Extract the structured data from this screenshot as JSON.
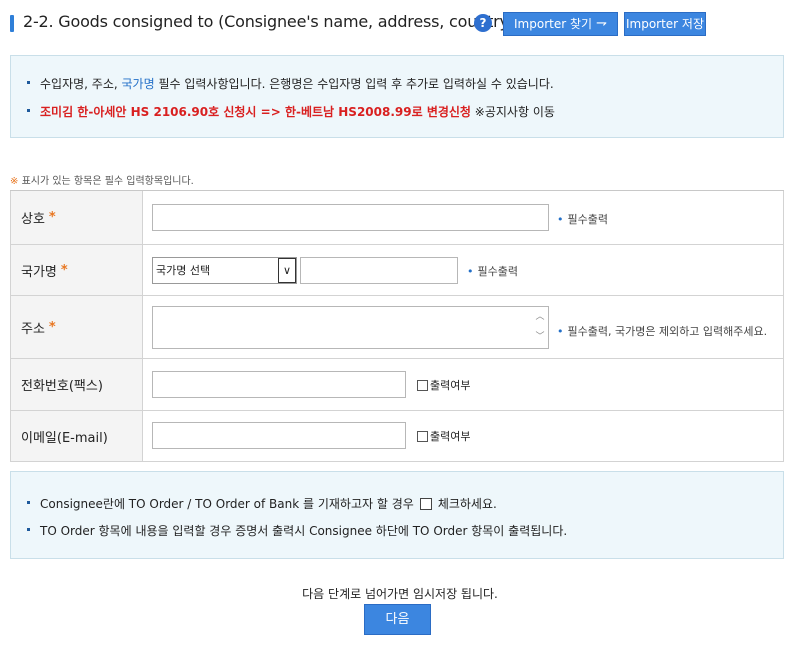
{
  "header": {
    "title": "2-2. Goods consigned to (Consignee's name, address, country)",
    "help_label": "?",
    "importer_find_label": "Importer 찾기",
    "importer_find_arrow": "⇁",
    "importer_save_label": "Importer 저장"
  },
  "notice_top": {
    "line1_part1": "수입자명, 주소, ",
    "line1_highlight": "국가명",
    "line1_part2": " 필수 입력사항입니다. 은행명은 수입자명 입력 후 추가로 입력하실 수 있습니다.",
    "line2_red": "조미김 한-아세안 HS 2106.90호 신청시 => 한-베트남 HS2008.99로 변경신청",
    "line2_black": " ※공지사항 이동"
  },
  "required_note": {
    "mark": "※",
    "text": " 표시가 있는 항목은 필수 입력항목입니다."
  },
  "form": {
    "company": {
      "label": "상호",
      "star": "*",
      "value": "",
      "hint": "필수출력"
    },
    "country": {
      "label": "국가명",
      "star": "*",
      "select_value": "국가명 선택",
      "caret": "∨",
      "value": "",
      "hint": "필수출력"
    },
    "address": {
      "label": "주소",
      "star": "*",
      "value": "",
      "scroll_up": "︿",
      "scroll_down": "﹀",
      "hint": "필수출력, 국가명은 제외하고 입력해주세요."
    },
    "phone": {
      "label": "전화번호(팩스)",
      "value": "",
      "checkbox_label": "출력여부"
    },
    "email": {
      "label": "이메일(E-mail)",
      "value": "",
      "checkbox_label": "출력여부"
    }
  },
  "notice_bottom": {
    "line1_part1": "Consignee란에 TO Order / TO Order of Bank 를 기재하고자 할 경우",
    "line1_part2": "체크하세요.",
    "line2": "TO Order 항목에 내용을 입력할 경우 증명서 출력시 Consignee 하단에 TO Order 항목이 출력됩니다."
  },
  "footer": {
    "message": "다음 단계로 넘어가면 임시저장 됩니다.",
    "next_label": "다음"
  },
  "colors": {
    "accent_blue": "#3c86e0",
    "required_orange": "#e87722",
    "notice_red": "#d92020",
    "notice_bg": "#eef7fb"
  }
}
